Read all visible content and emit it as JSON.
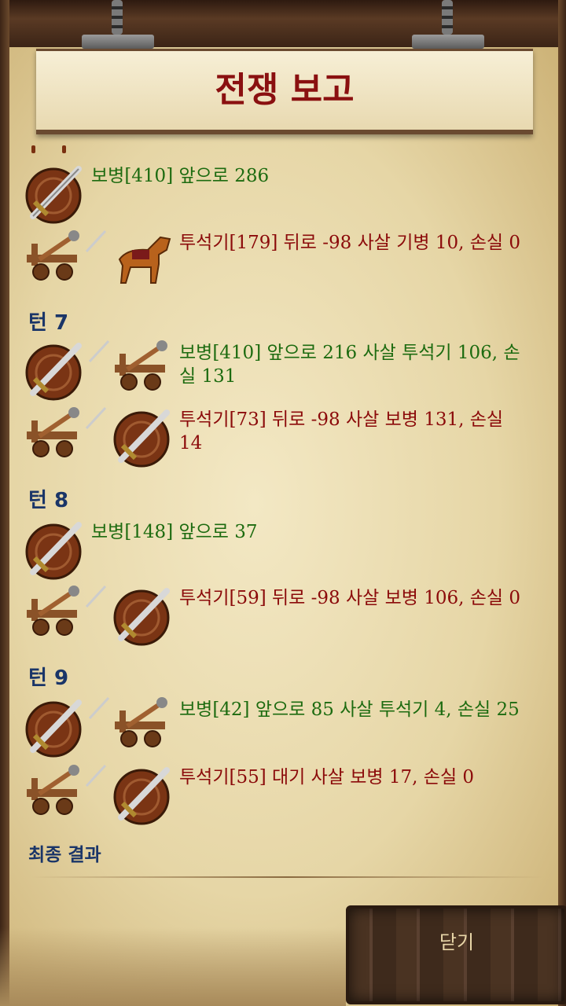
{
  "title": "전쟁 보고",
  "entries": [
    {
      "side": "green",
      "text": "보병[410] 앞으로 286",
      "icons": [
        "shield-sword-icon"
      ]
    },
    {
      "side": "red",
      "text": "투석기[179] 뒤로 -98 사살 기병 10, 손실 0",
      "icons": [
        "catapult-icon",
        "horse-icon"
      ]
    },
    {
      "side": "green",
      "text": "보병[410] 앞으로 216 사살 투석기 106, 손실 131",
      "icons": [
        "shield-sword-icon",
        "catapult-icon"
      ]
    },
    {
      "side": "red",
      "text": "투석기[73] 뒤로 -98 사살 보병 131, 손실 14",
      "icons": [
        "catapult-icon",
        "shield-sword-icon"
      ]
    },
    {
      "side": "green",
      "text": "보병[148] 앞으로 37",
      "icons": [
        "shield-sword-icon"
      ]
    },
    {
      "side": "red",
      "text": "투석기[59] 뒤로 -98 사살 보병 106, 손실 0",
      "icons": [
        "catapult-icon",
        "shield-sword-icon"
      ]
    },
    {
      "side": "green",
      "text": "보병[42] 앞으로 85 사살 투석기 4, 손실 25",
      "icons": [
        "shield-sword-icon",
        "catapult-icon"
      ]
    },
    {
      "side": "red",
      "text": "투석기[55] 대기 사살 보병 17, 손실 0",
      "icons": [
        "catapult-icon",
        "shield-sword-icon"
      ]
    }
  ],
  "turns": {
    "t7": "턴 7",
    "t8": "턴 8",
    "t9": "턴 9"
  },
  "final_result": "최종 결과",
  "close_label": "닫기",
  "colors": {
    "attacker_text": "#1d6b10",
    "defender_text": "#8b0a0a",
    "turn_text": "#1a3568",
    "title_text": "#8a1010"
  }
}
